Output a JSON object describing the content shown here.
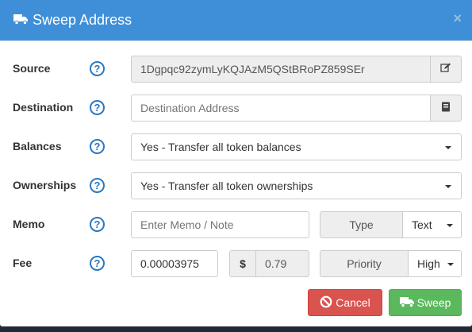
{
  "header": {
    "title": "Sweep Address",
    "close": "×"
  },
  "help_glyph": "?",
  "source": {
    "label": "Source",
    "value": "1Dgpqc92zymLyKQJAzM5QStBRoPZ859SEr",
    "addon_icon": "edit-icon"
  },
  "destination": {
    "label": "Destination",
    "placeholder": "Destination Address",
    "addon_icon": "address-book-icon"
  },
  "balances": {
    "label": "Balances",
    "selected": "Yes - Transfer all token balances"
  },
  "ownerships": {
    "label": "Ownerships",
    "selected": "Yes - Transfer all token ownerships"
  },
  "memo": {
    "label": "Memo",
    "placeholder": "Enter Memo / Note",
    "type_label": "Type",
    "type_selected": "Text"
  },
  "fee": {
    "label": "Fee",
    "amount": "0.00003975",
    "currency_symbol": "$",
    "usd_value": "0.79",
    "priority_label": "Priority",
    "priority_selected": "High"
  },
  "footer": {
    "cancel_label": "Cancel",
    "sweep_label": "Sweep"
  },
  "colors": {
    "header": "#3e8fd8",
    "help": "#2a78c2",
    "cancel": "#d9534f",
    "sweep": "#5cb85c"
  }
}
